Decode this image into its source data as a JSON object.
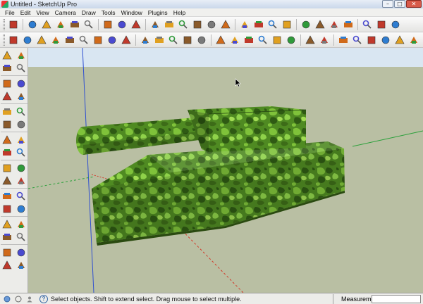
{
  "window": {
    "title": "Untitled - SketchUp Pro"
  },
  "menu": [
    "File",
    "Edit",
    "View",
    "Camera",
    "Draw",
    "Tools",
    "Window",
    "Plugins",
    "Help"
  ],
  "window_buttons": {
    "minimize": "–",
    "maximize": "□",
    "close": "✕"
  },
  "toolbar_top": [
    "select",
    "eraser",
    "line",
    "rectangle",
    "circle",
    "arc",
    "polygon",
    "make-component",
    "paint-bucket",
    "eraser-2",
    "tape-measure",
    "push-pull",
    "move",
    "rotate",
    "follow-me",
    "orbit",
    "pan",
    "zoom",
    "zoom-extents",
    "get-models",
    "share-model",
    "styles",
    "component",
    "warehouse",
    "section",
    "camera-position"
  ],
  "toolbar_second": [
    "view-iso",
    "view-top",
    "view-front",
    "view-right",
    "view-back",
    "view-left",
    "xray",
    "back-edges",
    "wireframe",
    "hidden-line",
    "shaded",
    "shaded-textures",
    "monochrome",
    "shadows",
    "fog",
    "edge-style",
    "profiles",
    "depth-cue",
    "extension",
    "axes",
    "guides",
    "section-planes",
    "iso-house",
    "top-house",
    "front-house",
    "right-house",
    "back-house",
    "left-house"
  ],
  "left_tools": [
    "select",
    "component",
    "paint",
    "eraser",
    "rectangle",
    "line",
    "circle",
    "arc",
    "polygon",
    "freehand",
    "move",
    "push-pull",
    "rotate",
    "follow-me",
    "scale",
    "offset",
    "tape-measure",
    "dimension",
    "protractor",
    "text",
    "axes",
    "3d-text",
    "orbit",
    "pan",
    "zoom",
    "zoom-window",
    "zoom-extents",
    "previous",
    "position-camera",
    "look-around",
    "walk",
    "section-plane"
  ],
  "status": {
    "message": "Select objects. Shift to extend select. Drag mouse to select multiple.",
    "measurements_label": "Measurements",
    "measurements_value": ""
  },
  "colors": {
    "sky": "#d9e6f2",
    "ground": "#b9bfa3",
    "camo_dark": "#2f5a14",
    "camo_mid": "#4f8a22",
    "camo_light": "#7fc23a",
    "axis_red": "#d23a2a",
    "axis_green": "#2aa03a",
    "axis_blue": "#3050d0"
  }
}
